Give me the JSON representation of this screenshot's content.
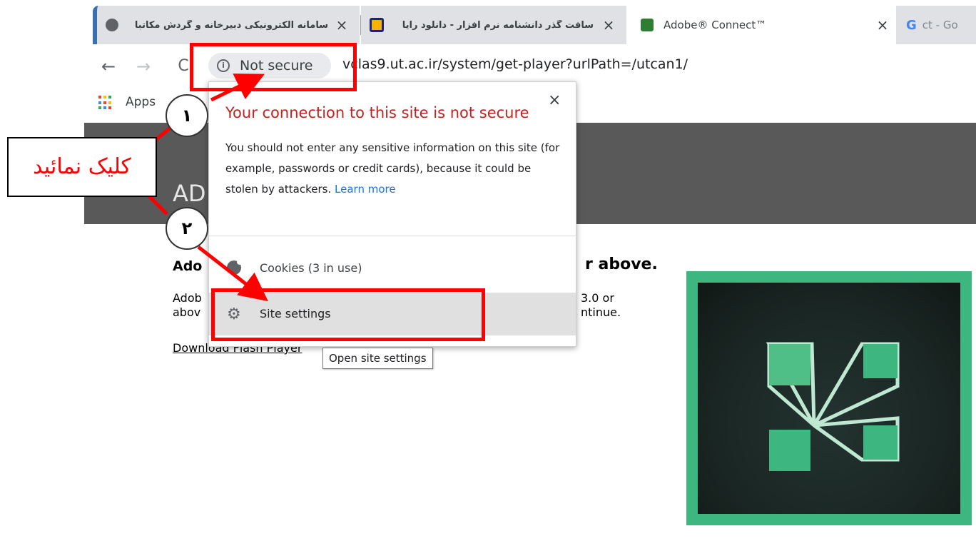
{
  "tabs": [
    {
      "title": "سامانه الکترونیکی دبیرخانه و گردش مکاتبا",
      "close": "×",
      "favicon_color": "#5f6368"
    },
    {
      "title": "سافت گذر دانشنامه نرم افزار - دانلود رایا",
      "close": "×",
      "favicon_color": "#f4b400"
    },
    {
      "title": "Adobe® Connect™",
      "close": "×",
      "favicon_color": "#2e7d32",
      "active": true
    },
    {
      "title": "ct - Go",
      "favicon_letter": "G"
    }
  ],
  "toolbar": {
    "back": "←",
    "forward": "→",
    "reload": "C",
    "security_label": "Not secure",
    "info_glyph": "i",
    "url": "vclas9.ut.ac.ir/system/get-player?urlPath=/utcan1/"
  },
  "bookmarks": {
    "apps_label": "Apps"
  },
  "page": {
    "header_text": "AD",
    "heading_left": "Ado",
    "heading_right": "r above.",
    "body_left_1": "Adob",
    "body_left_2": "abov",
    "body_right_1": "3.0 or",
    "body_right_2": "ntinue.",
    "download_link": "Download Flash Player"
  },
  "popup": {
    "title": "Your connection to this site is not secure",
    "close": "×",
    "body": "You should not enter any sensitive information on this site (for example, passwords or credit cards), because it could be stolen by attackers.",
    "learn_more": "Learn more",
    "cookies_label": "Cookies (3 in use)",
    "site_settings_label": "Site settings"
  },
  "tooltip": "Open site settings",
  "annotations": {
    "step1": "۱",
    "step2": "۲",
    "callout": "کلیک نمائید",
    "color": "#ff0000"
  },
  "colors": {
    "tab_inactive": "#dfe1e5",
    "header_bg": "#595959",
    "logo_green": "#3db77f",
    "warning_red": "#c5221f",
    "link_blue": "#1a73e8"
  }
}
